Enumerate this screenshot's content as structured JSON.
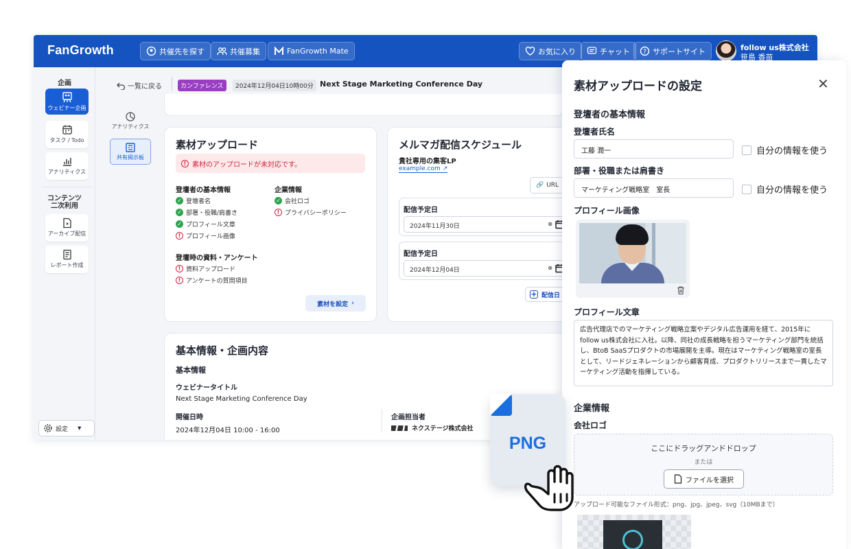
{
  "app": {
    "logo": "FanGrowth",
    "nav": {
      "find_partner": "共催先を探す",
      "recruit": "共催募集",
      "mate": "FanGrowth Mate",
      "favorites": "お気に入り",
      "chat": "チャット",
      "support": "サポートサイト"
    },
    "user": {
      "company": "follow us株式会社",
      "name": "笹島 香苗"
    },
    "colors": {
      "primary": "#1554c0",
      "accent": "#1a6ee0",
      "error": "#d21f3c",
      "success": "#2ea44f",
      "tag_purple": "#9a3fc4"
    }
  },
  "rail": {
    "section_plan": "企画",
    "webinar": "ウェビナー企画",
    "tasks": "タスク / Todo",
    "analytics": "アナリティクス",
    "section_content": "コンテンツ\n二次利用",
    "archive": "アーカイブ配信",
    "report": "レポート作成",
    "settings": "設定"
  },
  "subtabs": {
    "analytics": "アナリティクス",
    "board": "共有掲示板"
  },
  "breadcrumb": {
    "back": "一覧に戻る",
    "tag": "カンファレンス",
    "datetime": "2024年12月04日10時00分",
    "title": "Next Stage Marketing Conference Day"
  },
  "upload_card": {
    "title": "素材アップロード",
    "alert": "素材のアップロードが未対応です。",
    "speaker_head": "登壇者の基本情報",
    "speaker_items": [
      {
        "label": "登壇者名",
        "status": "ok"
      },
      {
        "label": "部署・役職/肩書き",
        "status": "ok"
      },
      {
        "label": "プロフィール文章",
        "status": "ok"
      },
      {
        "label": "プロフィール画像",
        "status": "ng"
      }
    ],
    "company_head": "企業情報",
    "company_items": [
      {
        "label": "会社ロゴ",
        "status": "ok"
      },
      {
        "label": "プライバシーポリシー",
        "status": "ng"
      }
    ],
    "material_head": "登壇時の資料・アンケート",
    "material_items": [
      {
        "label": "資料アップロード",
        "status": "ng"
      },
      {
        "label": "アンケートの質問項目",
        "status": "ng"
      }
    ],
    "button": "素材を設定"
  },
  "mail_card": {
    "title": "メルマガ配信スケジュール",
    "lp_label": "貴社専用の集客LP",
    "lp_link": "example.com",
    "url_button": "URL",
    "schedules": [
      {
        "label": "配信予定日",
        "date": "2024年11月30日"
      },
      {
        "label": "配信予定日",
        "date": "2024年12月04日"
      }
    ],
    "add_button": "配信日"
  },
  "info_card": {
    "title": "基本情報・企画内容",
    "sub": "基本情報",
    "webinar_title_label": "ウェビナータイトル",
    "webinar_title": "Next Stage Marketing Conference Day",
    "datetime_label": "開催日時",
    "datetime": "2024年12月04日 10:00 - 16:00",
    "owner_label": "企画担当者",
    "owner": "ネクステージ株式会社"
  },
  "drawer": {
    "title": "素材アップロードの設定",
    "speaker_section": "登壇者の基本情報",
    "name_label": "登壇者氏名",
    "name_value": "工藤 潤一",
    "use_my_info": "自分の情報を使う",
    "dept_label": "部署・役職または肩書き",
    "dept_value": "マーケティング戦略室　室長",
    "photo_label": "プロフィール画像",
    "bio_label": "プロフィール文章",
    "bio": "広告代理店でのマーケティング戦略立案やデジタル広告運用を経て、2015年にfollow us株式会社に入社。以降、同社の成長戦略を担うマーケティング部門を統括し、BtoB SaaSプロダクトの市場展開を主導。現在はマーケティング戦略室の室長として、リードジェネレーションから顧客育成、プロダクトリリースまで一貫したマーケティング活動を指揮している。",
    "company_section": "企業情報",
    "logo_label": "会社ロゴ",
    "drop_text": "ここにドラッグアンドドロップ",
    "or_text": "または",
    "select_file": "ファイルを選択",
    "formats": "アップロード可能なファイル形式：png、jpg、jpeg、svg（10MBまで）"
  },
  "file_overlay": {
    "label": "PNG"
  }
}
